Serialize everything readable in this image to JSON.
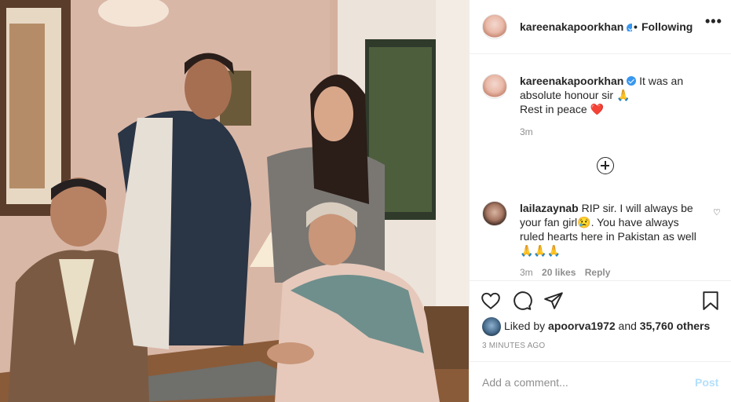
{
  "post": {
    "username": "kareenakapoorkhan",
    "follow_separator": "•",
    "follow_state": "Following",
    "more_label": "•••"
  },
  "caption": {
    "username": "kareenakapoorkhan",
    "text_line1": "It was an absolute honour sir 🙏",
    "text_line2": "Rest in peace ❤️",
    "time": "3m"
  },
  "comment": {
    "username": "lailazaynab",
    "text": "RIP sir. I will always be your fan girl😢. You have always ruled hearts here in Pakistan as well🙏🙏🙏",
    "time": "3m",
    "likes": "20 likes",
    "reply": "Reply",
    "heart_glyph": "♡"
  },
  "likes": {
    "prefix": "Liked by",
    "user": "apoorva1972",
    "conjunction": "and",
    "others": "35,760 others"
  },
  "post_time": "3 MINUTES AGO",
  "add_comment": {
    "placeholder": "Add a comment...",
    "post_label": "Post"
  },
  "colors": {
    "link_blue": "#3897f0",
    "post_disabled": "#b2dffc",
    "muted": "#8e8e8e"
  }
}
